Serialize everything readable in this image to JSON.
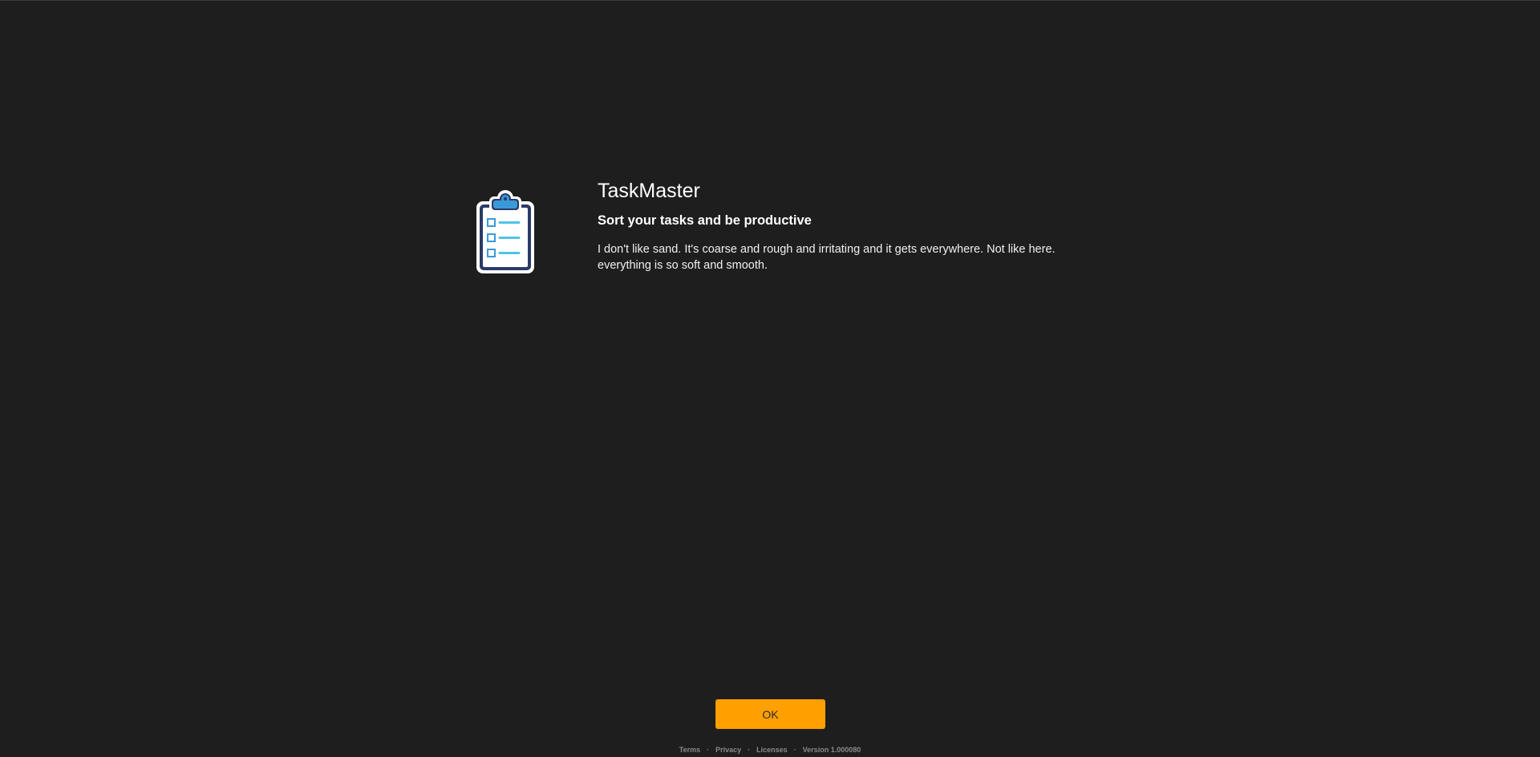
{
  "app": {
    "title": "TaskMaster",
    "tagline": "Sort your tasks and be productive",
    "description": "I don't like sand. It's coarse and rough and irritating and it gets everywhere. Not like here. everything is so soft and smooth.",
    "logo_icon": "clipboard-checklist-icon"
  },
  "actions": {
    "ok_label": "OK"
  },
  "footer": {
    "links": [
      "Terms",
      "Privacy",
      "Licenses"
    ],
    "separator": "·",
    "version": "Version 1.000080"
  },
  "colors": {
    "background": "#1e1e1e",
    "accent": "#ff9f00",
    "icon_blue": "#3a9ad9",
    "icon_cyan": "#4fc3e8",
    "icon_navy": "#2b3a67"
  }
}
